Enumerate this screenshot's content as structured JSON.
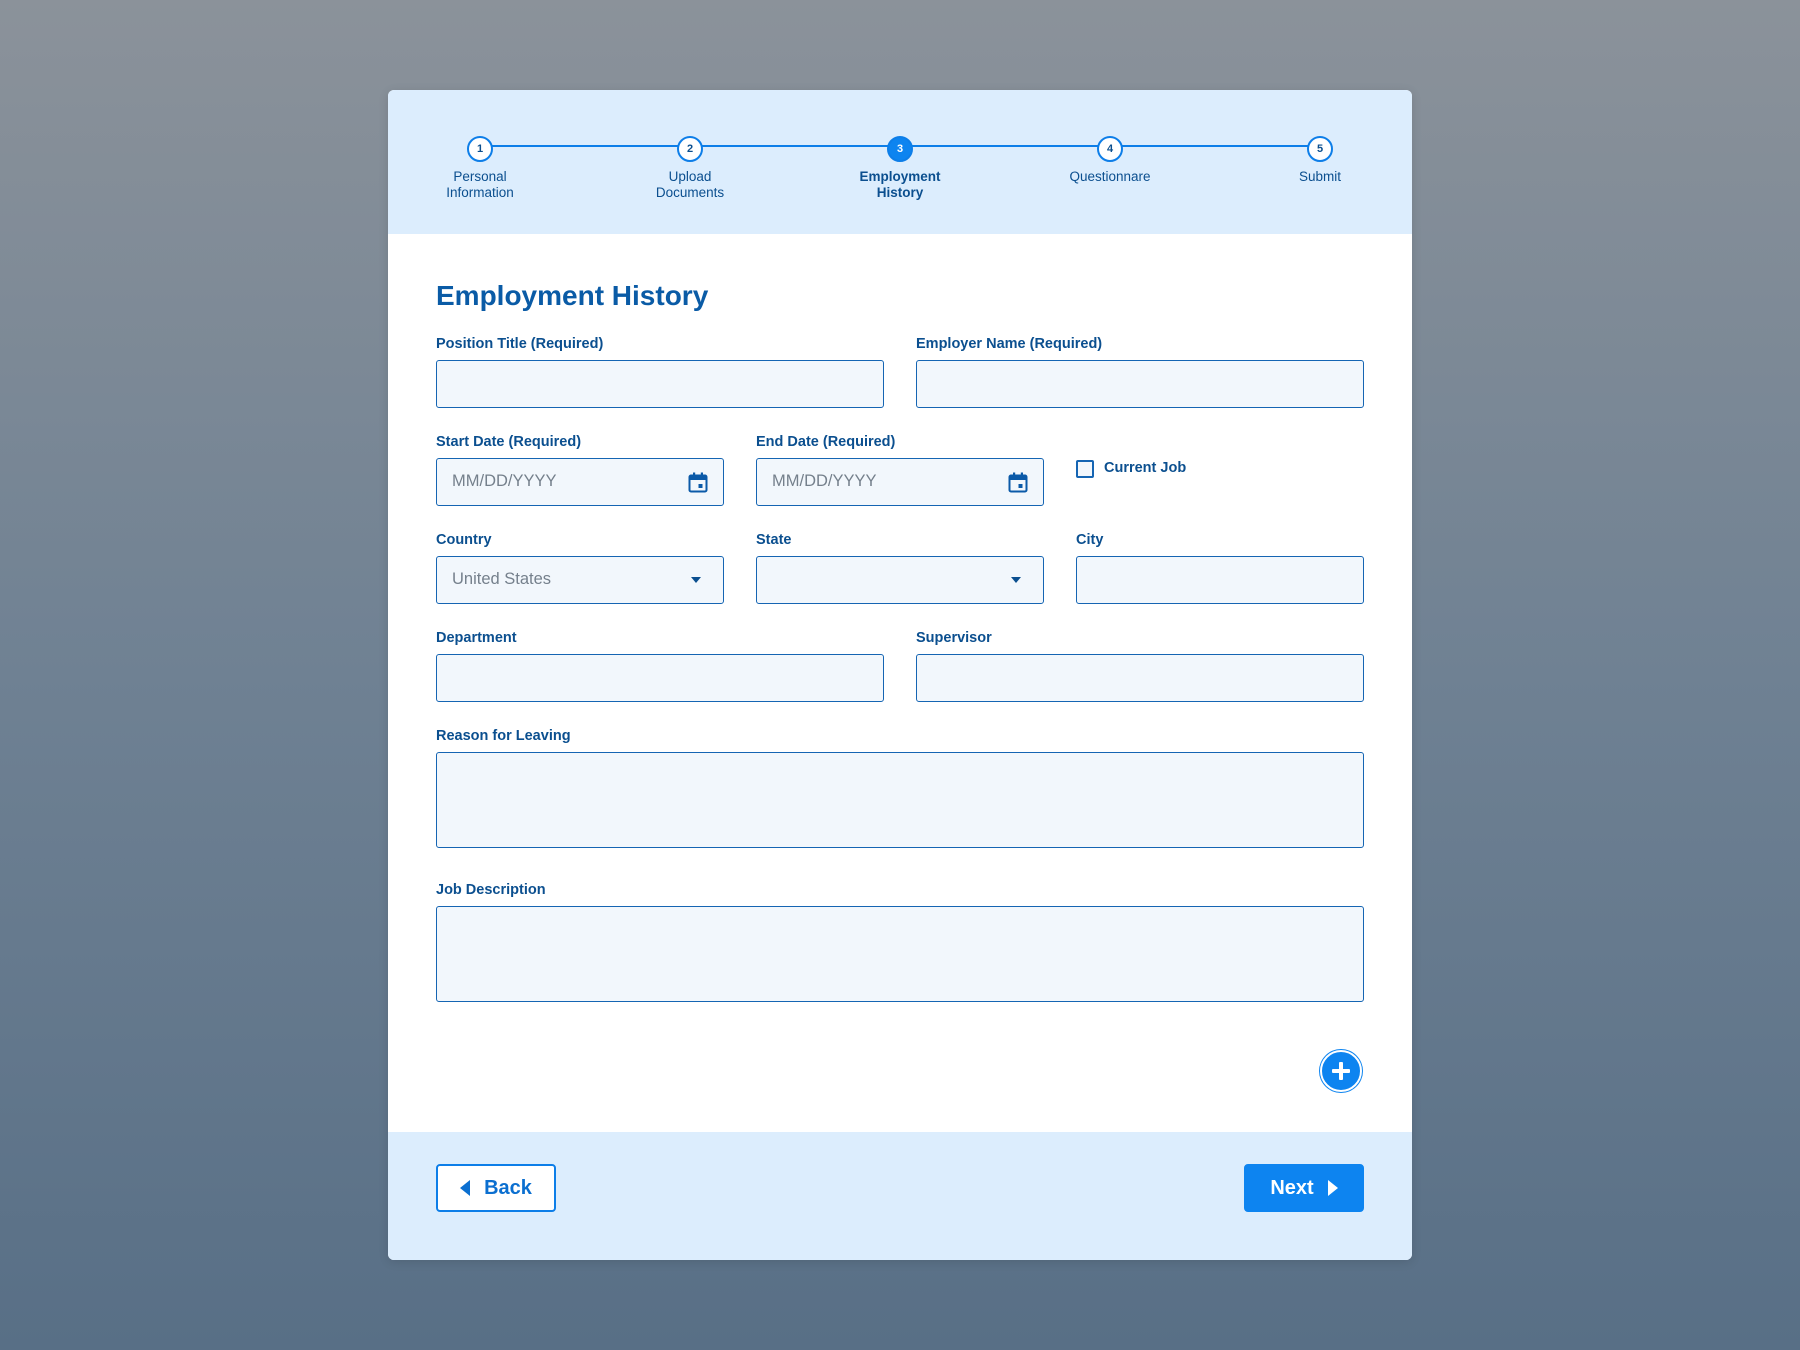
{
  "stepper": {
    "steps": [
      {
        "number": "1",
        "label": "Personal\nInformation",
        "state": "completed"
      },
      {
        "number": "2",
        "label": "Upload\nDocuments",
        "state": "completed"
      },
      {
        "number": "3",
        "label": "Employment\nHistory",
        "state": "active"
      },
      {
        "number": "4",
        "label": "Questionnare",
        "state": "upcoming"
      },
      {
        "number": "5",
        "label": "Submit",
        "state": "upcoming"
      }
    ]
  },
  "form": {
    "title": "Employment History",
    "position_title": {
      "label": "Position Title (Required)",
      "value": ""
    },
    "employer_name": {
      "label": "Employer Name (Required)",
      "value": ""
    },
    "start_date": {
      "label": "Start Date (Required)",
      "placeholder": "MM/DD/YYYY",
      "icon": "calendar-icon"
    },
    "end_date": {
      "label": "End Date (Required)",
      "placeholder": "MM/DD/YYYY",
      "icon": "calendar-icon"
    },
    "current_job": {
      "label": "Current Job",
      "checked": false
    },
    "country": {
      "label": "Country",
      "value": "United States",
      "icon": "chevron-down-icon"
    },
    "state": {
      "label": "State",
      "value": "",
      "icon": "chevron-down-icon"
    },
    "city": {
      "label": "City",
      "value": ""
    },
    "department": {
      "label": "Department",
      "value": ""
    },
    "supervisor": {
      "label": "Supervisor",
      "value": ""
    },
    "reason_for_leaving": {
      "label": "Reason for Leaving",
      "value": ""
    },
    "job_description": {
      "label": "Job Description",
      "value": ""
    },
    "add_button": {
      "icon": "plus-icon"
    }
  },
  "footer": {
    "back_label": "Back",
    "next_label": "Next"
  },
  "colors": {
    "accent": "#0d84f0",
    "heading": "#0a5ba6",
    "panel": "#dcedfd",
    "field_bg": "#f2f7fc"
  }
}
